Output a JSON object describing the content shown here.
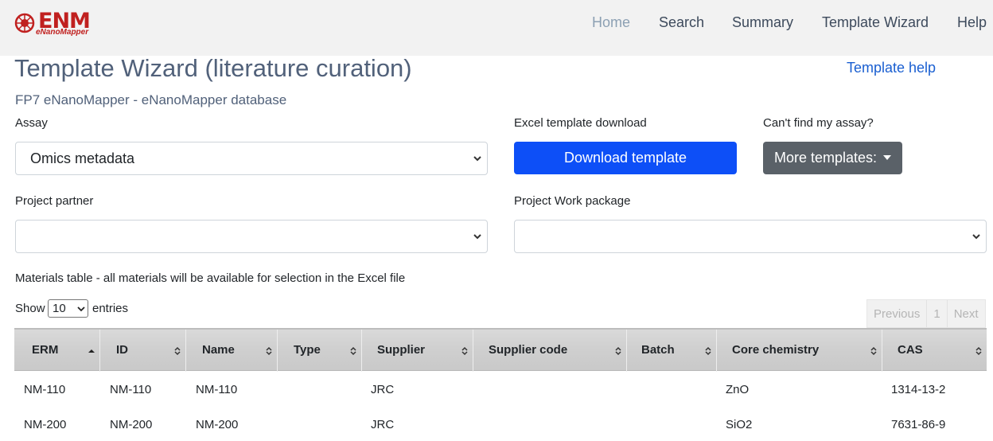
{
  "brand": {
    "name": "ENM",
    "subname": "eNanoMapper"
  },
  "nav": [
    {
      "label": "Home",
      "active": true
    },
    {
      "label": "Search"
    },
    {
      "label": "Summary"
    },
    {
      "label": "Template Wizard"
    },
    {
      "label": "Help"
    }
  ],
  "page": {
    "title": "Template Wizard (literature curation)",
    "help_link": "Template help",
    "subtitle": "FP7 eNanoMapper - eNanoMapper database"
  },
  "form": {
    "assay_label": "Assay",
    "assay_value": "Omics metadata",
    "excel_label": "Excel template download",
    "download_button": "Download template",
    "cant_find_label": "Can't find my assay?",
    "more_templates_button": "More templates:",
    "partner_label": "Project partner",
    "partner_value": "",
    "workpackage_label": "Project Work package",
    "workpackage_value": ""
  },
  "materials": {
    "caption": "Materials table - all materials will be available for selection in the Excel file",
    "show_label": "Show",
    "entries_value": "10",
    "entries_label": "entries",
    "pager": {
      "previous": "Previous",
      "page": "1",
      "next": "Next"
    },
    "columns": [
      "ERM",
      "ID",
      "Name",
      "Type",
      "Supplier",
      "Supplier code",
      "Batch",
      "Core chemistry",
      "CAS"
    ],
    "rows": [
      {
        "erm": "NM-110",
        "id": "NM-110",
        "name": "NM-110",
        "type": "",
        "supplier": "JRC",
        "supplier_code": "",
        "batch": "",
        "core": "ZnO",
        "cas": "1314-13-2"
      },
      {
        "erm": "NM-200",
        "id": "NM-200",
        "name": "NM-200",
        "type": "",
        "supplier": "JRC",
        "supplier_code": "",
        "batch": "",
        "core": "SiO2",
        "cas": "7631-86-9"
      }
    ]
  },
  "colors": {
    "brand_red": "#c0201f",
    "primary_button": "#0d4ff7",
    "secondary_button": "#5a6168",
    "heading": "#51617a",
    "link": "#1a5fd1"
  }
}
